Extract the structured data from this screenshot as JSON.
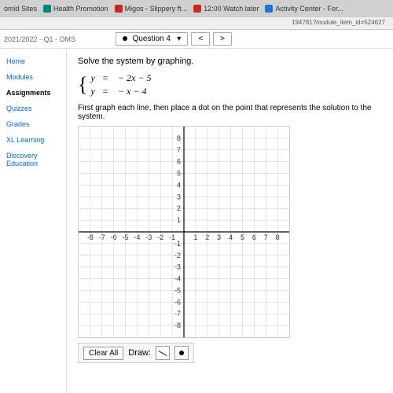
{
  "browser": {
    "tabs": [
      {
        "label": "omid Sites"
      },
      {
        "label": "Health Promotion"
      },
      {
        "label": "Migos - Slippery ft..."
      },
      {
        "label": "12:00 Watch later"
      },
      {
        "label": "Activity Center - For..."
      }
    ],
    "url_fragment": "194781?module_item_id=524627"
  },
  "breadcrumb": "2021/2022 - Q1 - OMS",
  "question_selector": {
    "label": "Question 4",
    "prev": "<",
    "next": ">"
  },
  "sidebar": {
    "items": [
      {
        "label": "Home"
      },
      {
        "label": "Modules"
      },
      {
        "label": "Assignments"
      },
      {
        "label": "Quizzes"
      },
      {
        "label": "Grades"
      },
      {
        "label": "XL Learning"
      },
      {
        "label": "Discovery Education"
      }
    ],
    "active_index": 2
  },
  "problem": {
    "instruction": "Solve the system by graphing.",
    "equations": {
      "line1_lhs": "y",
      "line1_eq": "=",
      "line1_rhs": "− 2x − 5",
      "line2_lhs": "y",
      "line2_eq": "=",
      "line2_rhs": "− x − 4"
    },
    "sub_instruction": "First graph each line, then place a dot on the point that represents the solution to the system."
  },
  "graph": {
    "x_min": -8,
    "x_max": 8,
    "y_min": -8,
    "y_max": 8,
    "ticks": [
      -8,
      -7,
      -6,
      -5,
      -4,
      -3,
      -2,
      -1,
      1,
      2,
      3,
      4,
      5,
      6,
      7,
      8
    ]
  },
  "draw_toolbar": {
    "clear_label": "Clear All",
    "draw_label": "Draw:"
  }
}
